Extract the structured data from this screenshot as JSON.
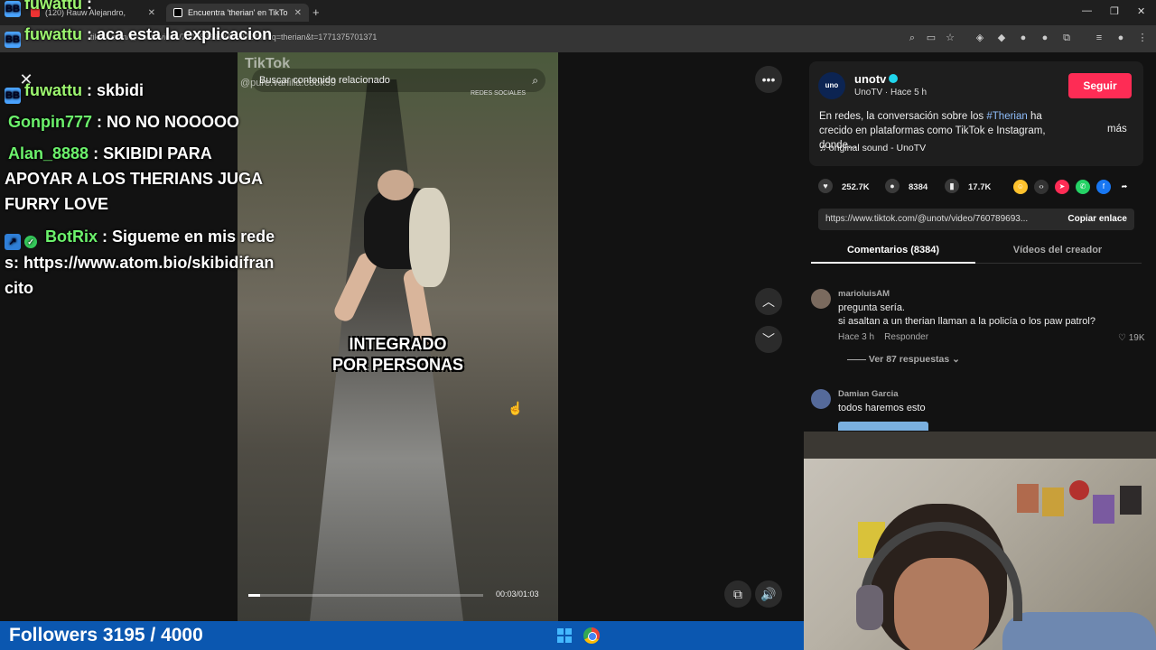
{
  "browser": {
    "tabs": [
      {
        "title": "(120) Rauw Alejandro,",
        "active": false
      },
      {
        "title": "Encuentra 'therian' en TikTo",
        "active": true
      }
    ],
    "url": "tiktok.com/@unotv/video/7607896938435972408?q=therian&t=1771375701371"
  },
  "chat": [
    {
      "user": "fuwattu",
      "text": ":",
      "badge": "bttv"
    },
    {
      "user": "fuwattu",
      "text": ": aca esta la explicacion",
      "badge": "bttv"
    },
    {
      "user": "fuwattu",
      "text": ": skbidi",
      "badge": "bttv"
    },
    {
      "user": "Gonpin777",
      "text": ": NO NO NOOOOO"
    },
    {
      "user": "Alan_8888",
      "text": ": SKIBIDI PARA APOYAR A LOS THERIANS JUGA FURRY LOVE"
    },
    {
      "user": "BotRix",
      "text": ": Sigueme en mis redes: https://www.atom.bio/skibidifrancito"
    }
  ],
  "video": {
    "logo": "TikTok",
    "handle": "@pure.vanilla.cook59",
    "search_placeholder": "Buscar contenido relacionado",
    "redes": "REDES SOCIALES",
    "caption_line1": "INTEGRADO",
    "caption_line2": "POR PERSONAS",
    "timecode": "00:03/01:03",
    "progress": 0.05
  },
  "creator": {
    "name": "unotv",
    "avatar_text": "uno",
    "subtitle": "UnoTV · Hace 5 h",
    "follow_label": "Seguir",
    "desc_pre": "En redes, la conversación sobre los ",
    "desc_hashtag": "#Therian",
    "desc_post": " ha crecido en plataformas como TikTok e Instagram, donde...",
    "more_label": "más",
    "sound": "original sound - UnoTV"
  },
  "stats": {
    "likes": "252.7K",
    "comments": "8384",
    "saves": "17.7K"
  },
  "link": {
    "url": "https://www.tiktok.com/@unotv/video/760789693...",
    "copy_label": "Copiar enlace"
  },
  "panel_tabs": {
    "comments": "Comentarios (8384)",
    "creator_videos": "Vídeos del creador"
  },
  "comments": [
    {
      "user": "marioluisAM",
      "line1": "pregunta sería.",
      "line2": "si asaltan a un therian llaman a la policía o los paw patrol?",
      "time": "Hace 3 h",
      "reply": "Responder",
      "likes": "19K",
      "replies": "Ver 87 respuestas"
    },
    {
      "user": "Damian Garcia",
      "line1": "todos haremos esto"
    }
  ],
  "bottom": {
    "followers": "Followers 3195 / 4000"
  },
  "colors": {
    "follow": "#fe2c55",
    "bottom_bar": "#0b57b0",
    "nick": "#9cf56f"
  }
}
